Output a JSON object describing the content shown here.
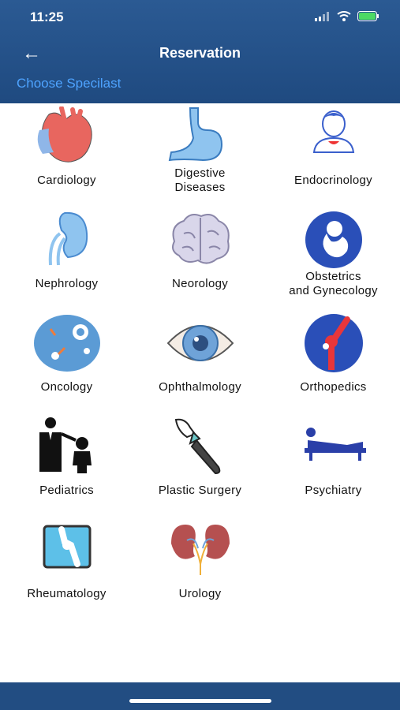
{
  "status": {
    "time": "11:25"
  },
  "header": {
    "title": "Reservation",
    "subtitle": "Choose Specilast"
  },
  "specialties": [
    {
      "label": "Cardiology",
      "icon": "heart-icon"
    },
    {
      "label": "Digestive\nDiseases",
      "icon": "stomach-icon"
    },
    {
      "label": "Endocrinology",
      "icon": "thyroid-person-icon"
    },
    {
      "label": "Nephrology",
      "icon": "kidney-icon"
    },
    {
      "label": "Neorology",
      "icon": "brain-icon"
    },
    {
      "label": "Obstetrics\nand Gynecology",
      "icon": "fetus-icon"
    },
    {
      "label": "Oncology",
      "icon": "cell-icon"
    },
    {
      "label": "Ophthalmology",
      "icon": "eye-icon"
    },
    {
      "label": "Orthopedics",
      "icon": "bone-joint-icon"
    },
    {
      "label": "Pediatrics",
      "icon": "doctor-child-icon"
    },
    {
      "label": "Plastic Surgery",
      "icon": "scalpel-icon"
    },
    {
      "label": "Psychiatry",
      "icon": "couch-icon"
    },
    {
      "label": "Rheumatology",
      "icon": "knee-xray-icon"
    },
    {
      "label": "Urology",
      "icon": "kidneys-bladder-icon"
    }
  ]
}
